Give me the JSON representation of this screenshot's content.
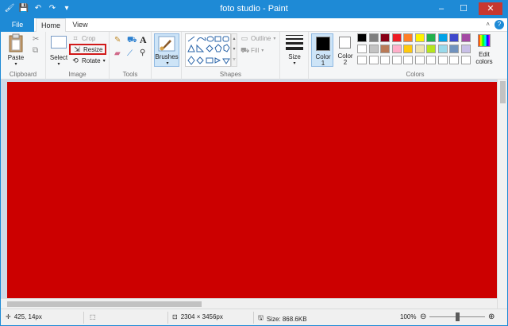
{
  "window": {
    "title": "foto studio - Paint",
    "qat_icons": [
      "paint-app-icon",
      "save-icon",
      "undo-icon",
      "redo-icon",
      "customize-icon"
    ],
    "controls": [
      "minimize-icon",
      "maximize-icon",
      "close-icon"
    ]
  },
  "tabs": {
    "file": "File",
    "home": "Home",
    "view": "View"
  },
  "ribbon": {
    "clipboard": {
      "label": "Clipboard",
      "paste": "Paste"
    },
    "image": {
      "label": "Image",
      "select": "Select",
      "crop": "Crop",
      "resize": "Resize",
      "rotate": "Rotate"
    },
    "tools": {
      "label": "Tools"
    },
    "brushes": {
      "label": "Brushes"
    },
    "shapes": {
      "label": "Shapes",
      "outline": "Outline",
      "fill": "Fill"
    },
    "size": {
      "label": "Size"
    },
    "color1": {
      "label": "Color",
      "num": "1",
      "value": "#000000"
    },
    "color2": {
      "label": "Color",
      "num": "2",
      "value": "#ffffff"
    },
    "colors": {
      "label": "Colors",
      "edit": "Edit",
      "edit2": "colors",
      "row1": [
        "#000000",
        "#7f7f7f",
        "#880015",
        "#ed1c24",
        "#ff7f27",
        "#fff200",
        "#22b14c",
        "#00a2e8",
        "#3f48cc",
        "#a349a4"
      ],
      "row2": [
        "#ffffff",
        "#c3c3c3",
        "#b97a57",
        "#ffaec9",
        "#ffc90e",
        "#efe4b0",
        "#b5e61d",
        "#99d9ea",
        "#7092be",
        "#c8bfe7"
      ],
      "row3": [
        "#ffffff",
        "#ffffff",
        "#ffffff",
        "#ffffff",
        "#ffffff",
        "#ffffff",
        "#ffffff",
        "#ffffff",
        "#ffffff",
        "#ffffff"
      ]
    }
  },
  "canvas": {
    "color": "#cc0000"
  },
  "status": {
    "cursor": "425, 14px",
    "dimensions": "2304 × 3456px",
    "size": "Size: 868.6KB",
    "zoom": "100%",
    "zoom_slider_fraction": 0.5
  }
}
